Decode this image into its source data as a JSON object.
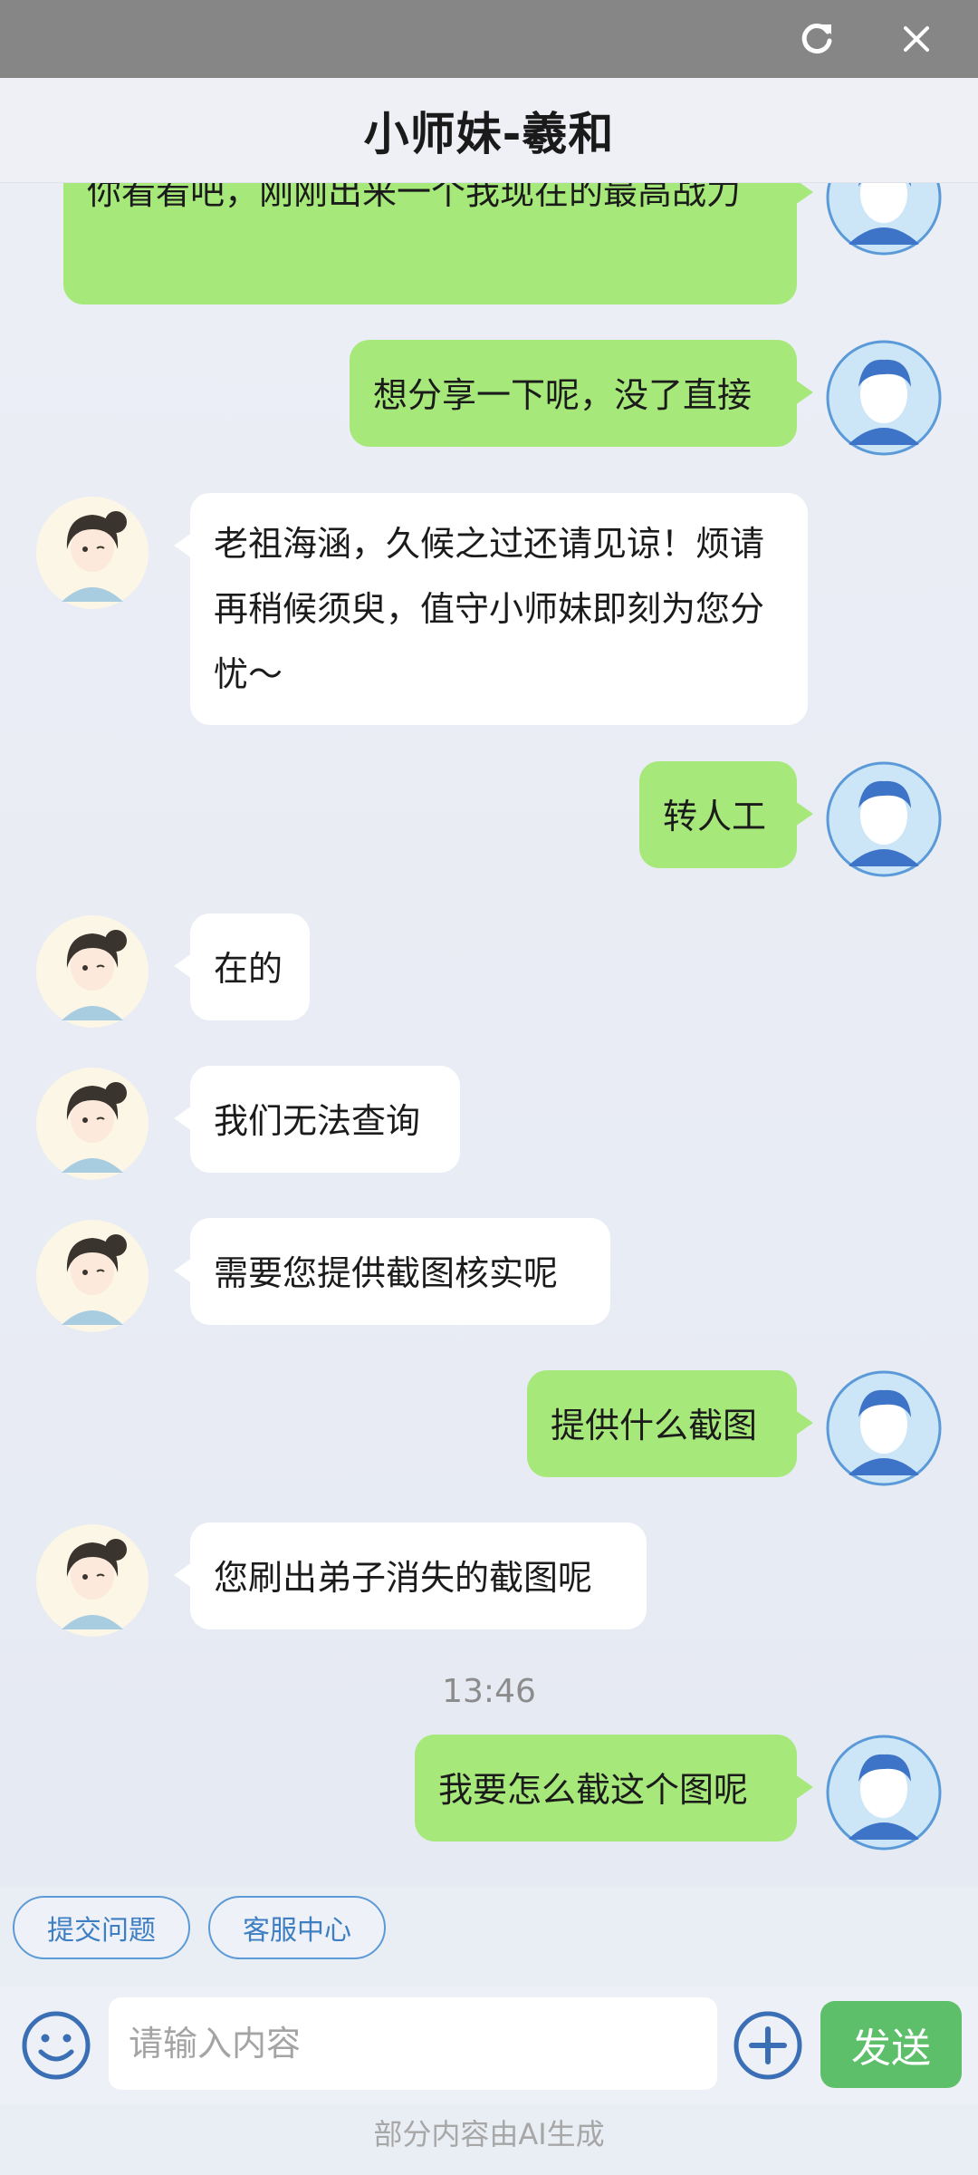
{
  "window": {
    "refresh_icon": "refresh-icon",
    "close_icon": "close-icon"
  },
  "header": {
    "title": "小师妹-羲和"
  },
  "messages": [
    {
      "from": "user",
      "text": "你看看吧，刚刚出来一个我现在的最高战力"
    },
    {
      "from": "user",
      "text": "想分享一下呢，没了直接"
    },
    {
      "from": "bot",
      "text": "老祖海涵，久候之过还请见谅！烦请再稍候须臾，值守小师妹即刻为您分忧～"
    },
    {
      "from": "user",
      "text": "转人工"
    },
    {
      "from": "bot",
      "text": "在的"
    },
    {
      "from": "bot",
      "text": "我们无法查询"
    },
    {
      "from": "bot",
      "text": "需要您提供截图核实呢"
    },
    {
      "from": "user",
      "text": "提供什么截图"
    },
    {
      "from": "bot",
      "text": "您刷出弟子消失的截图呢"
    },
    {
      "from": "user",
      "text": "我要怎么截这个图呢"
    }
  ],
  "timestamp": "13:46",
  "quick_actions": [
    {
      "label": "提交问题"
    },
    {
      "label": "客服中心"
    }
  ],
  "input": {
    "placeholder": "请输入内容",
    "value": "",
    "send_label": "发送"
  },
  "footer_note": "部分内容由AI生成",
  "colors": {
    "user_bubble": "#a6e87a",
    "bot_bubble": "#ffffff",
    "send_button": "#5dbf6a",
    "chip_border": "#5c9bd6"
  }
}
